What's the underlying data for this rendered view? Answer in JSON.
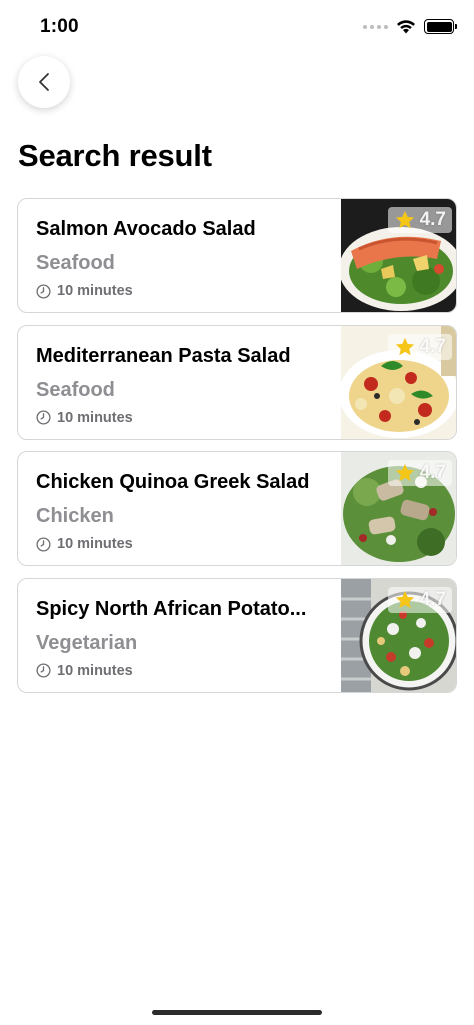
{
  "status_bar": {
    "time": "1:00"
  },
  "header": {
    "back_icon": "chevron-left-icon",
    "title": "Search result"
  },
  "results": [
    {
      "title": "Salmon Avocado Salad",
      "category": "Seafood",
      "duration": "10 minutes",
      "rating": "4.7",
      "image": "salmon-salad-photo"
    },
    {
      "title": "Mediterranean Pasta Salad",
      "category": "Seafood",
      "duration": "10 minutes",
      "rating": "4.7",
      "image": "pasta-salad-photo"
    },
    {
      "title": "Chicken Quinoa Greek Salad",
      "category": "Chicken",
      "duration": "10 minutes",
      "rating": "4.7",
      "image": "chicken-salad-photo"
    },
    {
      "title": "Spicy North African Potato...",
      "category": "Vegetarian",
      "duration": "10 minutes",
      "rating": "4.7",
      "image": "potato-salad-photo"
    }
  ],
  "colors": {
    "card_border": "#d6d6d6",
    "category_text": "#8e8e93",
    "star": "#f5c518"
  }
}
